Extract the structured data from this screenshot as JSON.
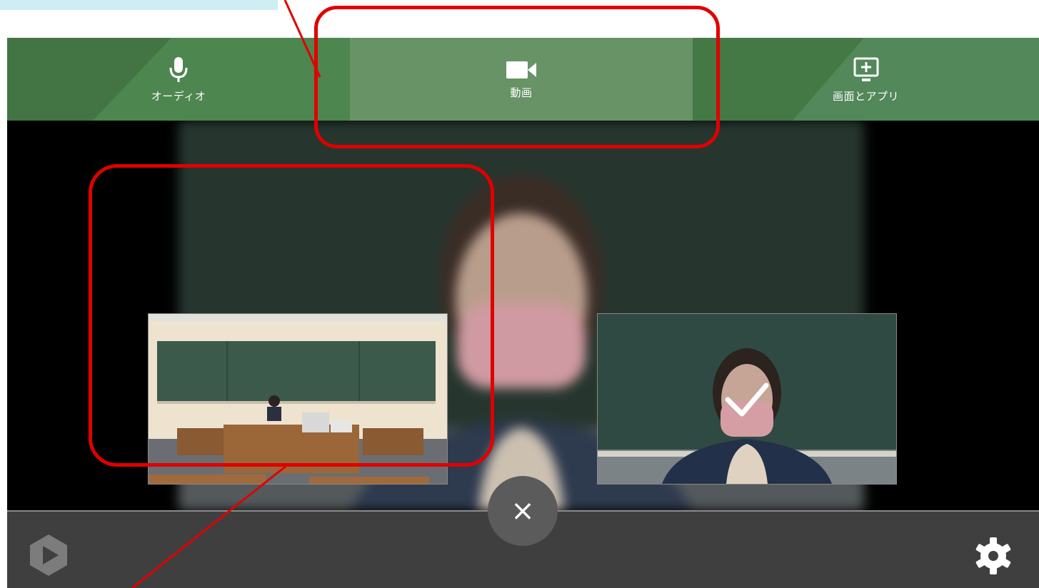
{
  "tabs": [
    {
      "label": "オーディオ",
      "icon": "microphone-icon",
      "active": false
    },
    {
      "label": "動画",
      "icon": "video-camera-icon",
      "active": true
    },
    {
      "label": "画面とアプリ",
      "icon": "screen-share-icon",
      "active": false
    }
  ],
  "close_button": {
    "glyph": "×"
  },
  "colors": {
    "header_green": "#4a7f4b",
    "active_tab_green": "#6d9a6e",
    "annotation_red": "#e00000",
    "bottom_bar": "#3f3f3f",
    "close_button": "#5b5b5b"
  },
  "cameras": [
    {
      "name": "classroom-camera",
      "selected": false
    },
    {
      "name": "presenter-camera",
      "selected": true
    }
  ]
}
